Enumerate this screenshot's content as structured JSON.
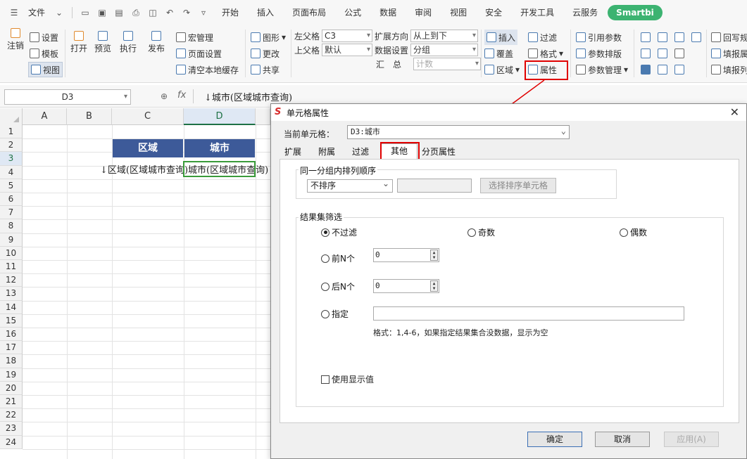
{
  "menubar": {
    "file_label": "文件",
    "tabs": [
      "开始",
      "插入",
      "页面布局",
      "公式",
      "数据",
      "审阅",
      "视图",
      "安全",
      "开发工具",
      "云服务"
    ],
    "smartbi_label": "Smartbi"
  },
  "ribbon": {
    "logout": "注销",
    "settings": "设置",
    "template": "模板",
    "view": "视图",
    "open": "打开",
    "preview": "预览",
    "execute": "执行",
    "publish": "发布",
    "macro_manager": "宏管理",
    "page_setup": "页面设置",
    "clear_cache": "清空本地缓存",
    "chart": "图形",
    "change": "更改",
    "share": "共享",
    "left_parent_label": "左父格",
    "left_parent_value": "C3",
    "upper_parent_label": "上父格",
    "upper_parent_value": "默认",
    "expand_dir_label": "扩展方向",
    "expand_dir_value": "从上到下",
    "data_setting_label": "数据设置",
    "data_setting_value": "分组",
    "summary_label": "汇　总",
    "summary_value": "计数",
    "insert": "插入",
    "overlay": "覆盖",
    "region": "区域",
    "filter": "过滤",
    "format": "格式",
    "property": "属性",
    "ref_param": "引用参数",
    "param_layout": "参数排版",
    "param_manage": "参数管理",
    "writeback": "回写规",
    "fill_report": "填报属",
    "fill_list": "填报列"
  },
  "formula_bar": {
    "cell_ref": "D3",
    "fx": "fx",
    "formula": "↓城市(区域城市查询)"
  },
  "sheet": {
    "columns": [
      "A",
      "B",
      "C",
      "D"
    ],
    "rows": [
      "1",
      "2",
      "3",
      "4",
      "5",
      "6",
      "7",
      "8",
      "9",
      "10",
      "11",
      "12",
      "13",
      "14",
      "15",
      "16",
      "17",
      "18",
      "19",
      "20",
      "21",
      "22",
      "23",
      "24"
    ],
    "c2": "区域",
    "d2": "城市",
    "c3": "↓区域(区域城市查询)",
    "d3": "城市(区域城市查询)"
  },
  "dialog": {
    "title": "单元格属性",
    "current_cell_label": "当前单元格：",
    "current_cell_value": "D3:城市",
    "tabs": [
      "扩展",
      "附属",
      "过滤",
      "其他",
      "分页属性"
    ],
    "sort_group_label": "同一分组内排列顺序",
    "sort_select": "不排序",
    "sort_button": "选择排序单元格",
    "filter_group_label": "结果集筛选",
    "radio_no_filter": "不过滤",
    "radio_odd": "奇数",
    "radio_even": "偶数",
    "radio_first_n": "前N个",
    "first_n_value": "0",
    "radio_last_n": "后N个",
    "last_n_value": "0",
    "radio_specify": "指定",
    "format_hint": "格式：1,4-6，如果指定结果集合没数据，显示为空",
    "use_display_value": "使用显示值",
    "ok": "确定",
    "cancel": "取消",
    "apply": "应用(A)"
  }
}
